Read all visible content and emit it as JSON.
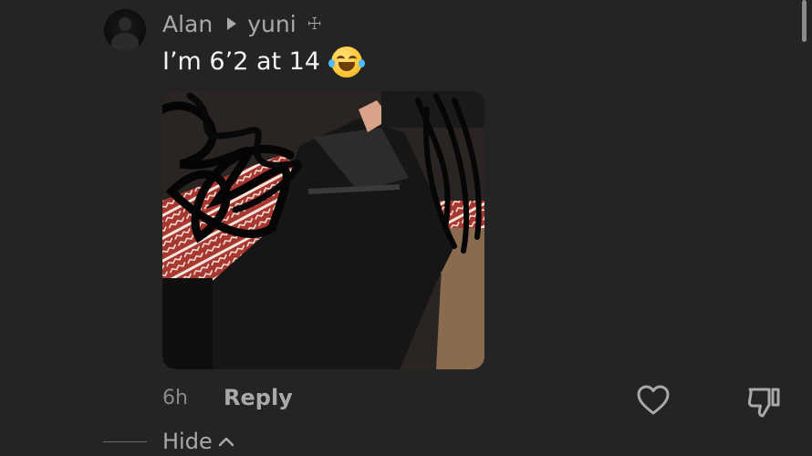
{
  "comment": {
    "author": "Alan",
    "reply_to": "yuni",
    "reply_to_symbol": "☩",
    "text": "I’m 6’2 at 14",
    "time": "6h",
    "reply_label": "Reply",
    "hide_label": "Hide"
  },
  "icons": {
    "avatar": "avatar-icon",
    "reply_arrow": "reply-arrow-icon",
    "emoji": "face-with-tears-of-joy-icon",
    "like": "heart-outline-icon",
    "dislike": "thumbs-down-icon",
    "hide_chevron": "chevron-up-icon"
  },
  "colors": {
    "background": "#242424",
    "primary_text": "#f2f2f2",
    "secondary_text": "#a9a9a9",
    "muted_text": "#8a8a8a"
  }
}
